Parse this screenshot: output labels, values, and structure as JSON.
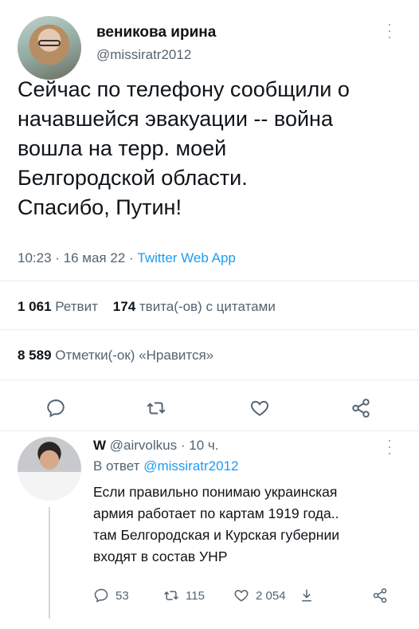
{
  "tweet": {
    "display_name": "веникова ирина",
    "handle": "@missiratr2012",
    "text_lines": [
      "Сейчас по телефону сообщили о",
      "начавшейся эвакуации -- война",
      "вошла на терр. моей",
      "Белгородской области.",
      "Спасибо, Путин!"
    ],
    "time": "10:23",
    "dot1": " · ",
    "date": "16 мая 22",
    "dot2": " · ",
    "source": "Twitter Web App",
    "retweets_count": "1 061",
    "retweets_label": "Ретвит",
    "quotes_count": "174",
    "quotes_label": "твита(-ов) с цитатами",
    "likes_count": "8 589",
    "likes_label": "Отметки(-ок) «Нравится»"
  },
  "icons": {
    "reply": "reply-icon",
    "retweet": "retweet-icon",
    "like": "heart-icon",
    "share": "share-icon",
    "more": "more-icon",
    "stats": "stats-icon"
  },
  "reply": {
    "display_name": "W",
    "handle": "@airvolkus",
    "separator": " · ",
    "time": "10 ч.",
    "replying_prefix": "В ответ",
    "replying_to": "@missiratr2012",
    "text_lines": [
      "Если правильно понимаю украинская",
      "армия работает по картам 1919 года..",
      "там Белгородская и Курская губернии",
      "входят в состав УНР"
    ],
    "replies": "53",
    "retweets": "115",
    "likes": "2 054"
  },
  "colors": {
    "accent": "#1d9bf0",
    "secondary_text": "#536471",
    "primary_text": "#0f1419",
    "divider": "#e6ecf0"
  }
}
